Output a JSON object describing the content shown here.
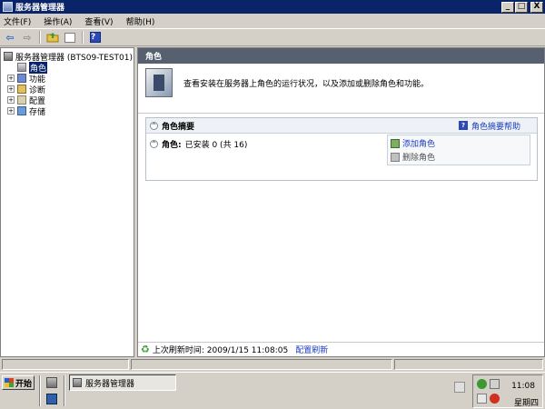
{
  "window": {
    "title": "服务器管理器",
    "controls": {
      "minimize": "_",
      "maximize": "□",
      "close": "X"
    }
  },
  "menu": [
    "文件(F)",
    "操作(A)",
    "查看(V)",
    "帮助(H)"
  ],
  "toolbar": {
    "icons": [
      "back-arrow-icon",
      "forward-arrow-icon",
      "up-folder-icon",
      "show-hide-tree-icon",
      "help-icon"
    ],
    "glyphs": {
      "back": "⇦",
      "forward": "⇨",
      "up": "📁",
      "view": "▤",
      "help": "?"
    }
  },
  "tree": {
    "root": "服务器管理器 (BTS09-TEST01)",
    "items": [
      {
        "label": "角色",
        "selected": true,
        "expandable": false
      },
      {
        "label": "功能",
        "selected": false,
        "expandable": true
      },
      {
        "label": "诊断",
        "selected": false,
        "expandable": true
      },
      {
        "label": "配置",
        "selected": false,
        "expandable": true
      },
      {
        "label": "存储",
        "selected": false,
        "expandable": true
      }
    ],
    "expander_glyph": "+"
  },
  "content": {
    "header": "角色",
    "intro": "查看安装在服务器上角色的运行状况，以及添加或删除角色和功能。",
    "summary": {
      "title": "角色摘要",
      "help_link": "角色摘要帮助",
      "collapse_glyph": "^",
      "roles_label": "角色:",
      "roles_value": "已安装 0 (共 16)",
      "actions": [
        {
          "label": "添加角色",
          "enabled": true
        },
        {
          "label": "删除角色",
          "enabled": false
        }
      ]
    },
    "refresh": {
      "label": "上次刷新时间: 2009/1/15 11:08:05",
      "link": "配置刷新",
      "glyph": "♻"
    }
  },
  "taskbar": {
    "start": "开始",
    "task": "服务器管理器",
    "clock": "11:08",
    "day": "星期四"
  },
  "colors": {
    "titlebar": "#0a246a",
    "pane_header": "#56606e",
    "link": "#1a3cc0",
    "selection": "#0a246a"
  }
}
